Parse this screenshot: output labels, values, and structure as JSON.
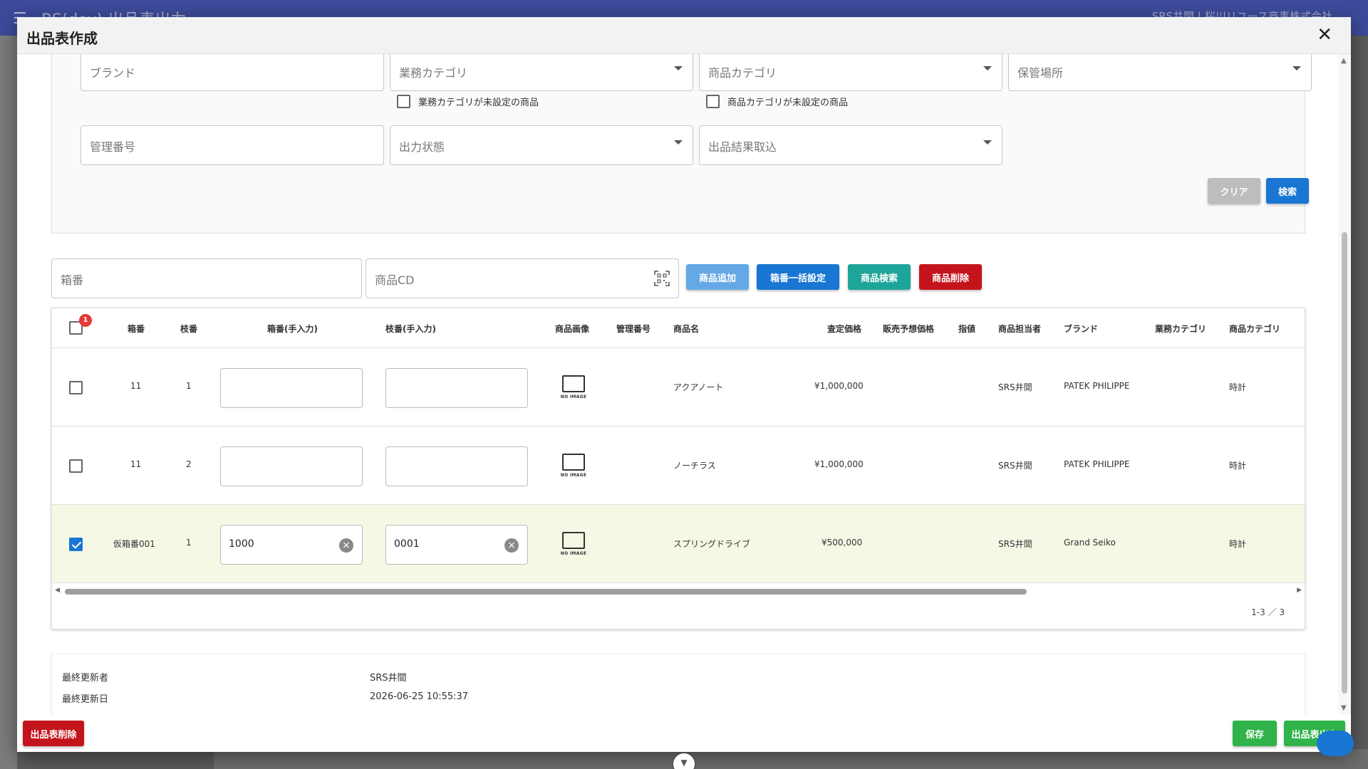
{
  "background": {
    "title": "BS(dev) 出品表出力",
    "user": "SRS井間 | 桜川リユース商事株式会社"
  },
  "dialog": {
    "title": "出品表作成",
    "close_icon": "close-icon"
  },
  "filters": {
    "brand": "ブランド",
    "business_category": "業務カテゴリ",
    "product_category": "商品カテゴリ",
    "storage": "保管場所",
    "business_category_unset": "業務カテゴリが未設定の商品",
    "product_category_unset": "商品カテゴリが未設定の商品",
    "management_no": "管理番号",
    "output_status": "出力状態",
    "result_import": "出品結果取込",
    "clear_label": "クリア",
    "search_label": "検索"
  },
  "entry": {
    "box_no_placeholder": "箱番",
    "product_cd_placeholder": "商品CD",
    "add_label": "商品追加",
    "bulk_box_label": "箱番一括設定",
    "product_search_label": "商品検索",
    "delete_label": "商品削除"
  },
  "table": {
    "selected_badge": "1",
    "headers": {
      "box_no": "箱番",
      "branch_no": "枝番",
      "box_no_manual": "箱番(手入力)",
      "branch_no_manual": "枝番(手入力)",
      "image": "商品画像",
      "management_no": "管理番号",
      "product_name": "商品名",
      "appraisal_price": "査定価格",
      "expected_price": "販売予想価格",
      "limit_price": "指値",
      "staff": "商品担当者",
      "brand": "ブランド",
      "business_category": "業務カテゴリ",
      "product_category": "商品カテゴリ"
    },
    "no_image_label": "NO IMAGE",
    "rows": [
      {
        "checked": false,
        "box_no": "11",
        "branch_no": "1",
        "box_manual": "",
        "branch_manual": "",
        "name": "アクアノート",
        "appraisal": "¥1,000,000",
        "staff": "SRS井間",
        "brand": "PATEK PHILIPPE",
        "product_category": "時計"
      },
      {
        "checked": false,
        "box_no": "11",
        "branch_no": "2",
        "box_manual": "",
        "branch_manual": "",
        "name": "ノーチラス",
        "appraisal": "¥1,000,000",
        "staff": "SRS井間",
        "brand": "PATEK PHILIPPE",
        "product_category": "時計"
      },
      {
        "checked": true,
        "box_no": "仮箱番001",
        "branch_no": "1",
        "box_manual": "1000",
        "branch_manual": "0001",
        "name": "スプリングドライブ",
        "appraisal": "¥500,000",
        "staff": "SRS井間",
        "brand": "Grand Seiko",
        "product_category": "時計"
      }
    ],
    "pagination": "1-3 ／ 3"
  },
  "audit": {
    "updated_by_label": "最終更新者",
    "updated_by": "SRS井間",
    "updated_at_label": "最終更新日",
    "updated_at": "2026-06-25 10:55:37"
  },
  "footer": {
    "delete_label": "出品表削除",
    "save_label": "保存",
    "export_label": "出品表出力"
  }
}
